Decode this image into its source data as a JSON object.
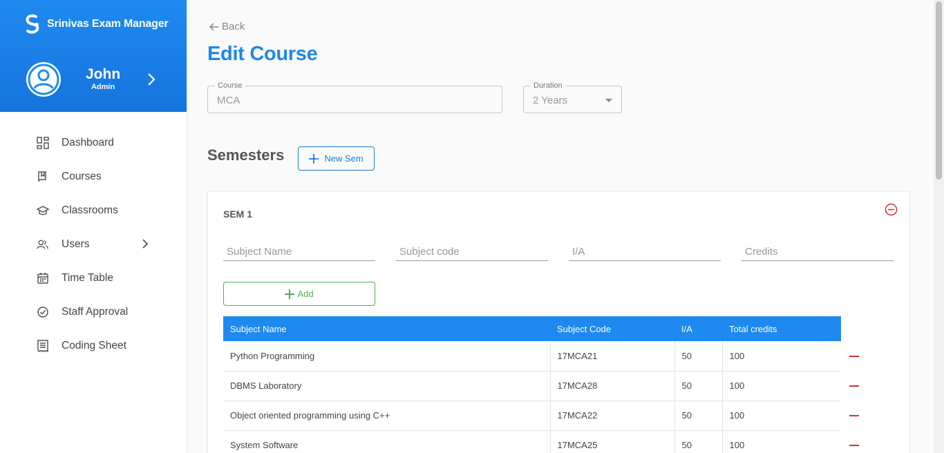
{
  "app": {
    "brand_name": "Srinivas Exam Manager",
    "accent_color": "#1e8af0",
    "add_color": "#4caf50",
    "remove_color": "#d32f2f"
  },
  "user": {
    "name": "John",
    "role": "Admin"
  },
  "sidebar": {
    "items": [
      {
        "label": "Dashboard",
        "icon": "dashboard-icon"
      },
      {
        "label": "Courses",
        "icon": "courses-icon"
      },
      {
        "label": "Classrooms",
        "icon": "classrooms-icon"
      },
      {
        "label": "Users",
        "icon": "users-icon",
        "has_submenu": true
      },
      {
        "label": "Time Table",
        "icon": "calendar-icon"
      },
      {
        "label": "Staff Approval",
        "icon": "check-circle-icon"
      },
      {
        "label": "Coding Sheet",
        "icon": "receipt-icon"
      }
    ]
  },
  "page": {
    "back_label": "Back",
    "title": "Edit Course",
    "course": {
      "label": "Course",
      "value": "MCA"
    },
    "duration": {
      "label": "Duration",
      "value": "2 Years"
    },
    "semesters_title": "Semesters",
    "new_sem_label": "New Sem"
  },
  "semester": {
    "title": "SEM 1",
    "inputs": {
      "subject_name_placeholder": "Subject Name",
      "subject_code_placeholder": "Subject code",
      "ia_placeholder": "I/A",
      "credits_placeholder": "Credits"
    },
    "add_label": "Add",
    "table": {
      "columns": [
        "Subject Name",
        "Subject Code",
        "I/A",
        "Total credits"
      ],
      "rows": [
        [
          "Python Programming",
          "17MCA21",
          "50",
          "100"
        ],
        [
          "DBMS Laboratory",
          "17MCA28",
          "50",
          "100"
        ],
        [
          "Object oriented programming using C++",
          "17MCA22",
          "50",
          "100"
        ],
        [
          "System Software",
          "17MCA25",
          "50",
          "100"
        ]
      ]
    }
  }
}
